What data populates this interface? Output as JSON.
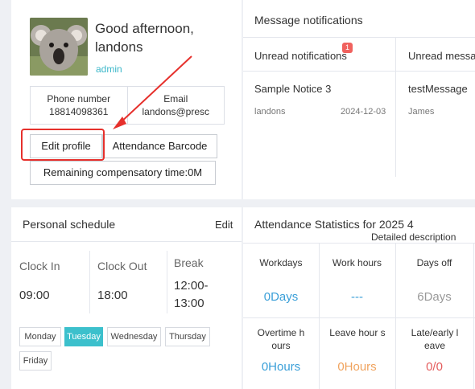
{
  "profile": {
    "greeting": "Good afternoon, landons",
    "role": "admin",
    "phone_label": "Phone number",
    "phone_value": "18814098361",
    "email_label": "Email",
    "email_value": "landons@presc",
    "edit_profile_label": "Edit profile",
    "attendance_barcode_label": "Attendance Barcode",
    "remaining_comp_label": "Remaining compensatory time:0M"
  },
  "messages": {
    "title": "Message notifications",
    "tabs": [
      {
        "label": "Unread notifications",
        "badge": "1"
      },
      {
        "label": "Unread messag"
      }
    ],
    "notices": [
      {
        "title": "Sample Notice 3",
        "author": "landons",
        "date": "2024-12-03"
      }
    ],
    "msgs": [
      {
        "title": "testMessage",
        "author": "James"
      }
    ]
  },
  "schedule": {
    "title": "Personal schedule",
    "edit_label": "Edit",
    "columns": [
      {
        "label": "Clock In",
        "value": "09:00"
      },
      {
        "label": "Clock Out",
        "value": "18:00"
      },
      {
        "label": "Break",
        "value": "12:00-13:00"
      }
    ],
    "days": [
      "Monday",
      "Tuesday",
      "Wednesday",
      "Thursday",
      "Friday"
    ],
    "active_day": "Tuesday"
  },
  "stats": {
    "title": "Attendance Statistics for 2025 4",
    "detail_label": "Detailed description",
    "row1": [
      {
        "label": "Workdays",
        "value": "0Days"
      },
      {
        "label": "Work hours",
        "value": "---"
      },
      {
        "label": "Days off",
        "value": "6Days"
      }
    ],
    "row2": [
      {
        "label": "Overtime h ours",
        "value": "0Hours"
      },
      {
        "label": "Leave hour s",
        "value": "0Hours"
      },
      {
        "label": "Late/early l eave",
        "value": "0/0"
      }
    ]
  },
  "colors": {
    "accent": "#3cc0cc",
    "blue_value": "#3a9fd8",
    "orange_value": "#f0a35e",
    "red_value": "#e45d5d",
    "grey_value": "#999999",
    "annotation": "#e6302c"
  }
}
